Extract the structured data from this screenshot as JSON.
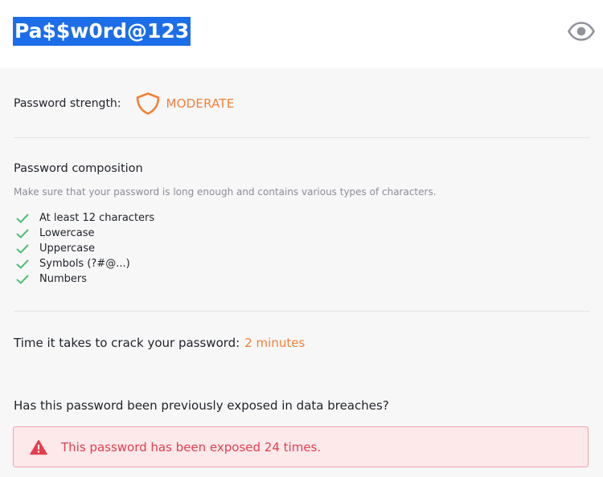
{
  "password": {
    "value": "Pa$$w0rd@123",
    "toggle_visibility_icon": "eye-icon"
  },
  "strength": {
    "label": "Password strength:",
    "value": "MODERATE",
    "icon": "shield-icon",
    "color": "#f2813a"
  },
  "composition": {
    "title": "Password composition",
    "description": "Make sure that your password is long enough and contains various types of characters.",
    "check_icon": "check-icon",
    "check_color": "#4fbf73",
    "items": [
      {
        "label": "At least 12 characters"
      },
      {
        "label": "Lowercase"
      },
      {
        "label": "Uppercase"
      },
      {
        "label": "Symbols (?#@...)"
      },
      {
        "label": "Numbers"
      }
    ]
  },
  "crack_time": {
    "label": "Time it takes to crack your password:",
    "value": "2 minutes"
  },
  "breach": {
    "question": "Has this password been previously exposed in data breaches?",
    "alert_text": "This password has been exposed 24 times.",
    "alert_icon": "warning-icon",
    "alert_color": "#e0404e"
  }
}
